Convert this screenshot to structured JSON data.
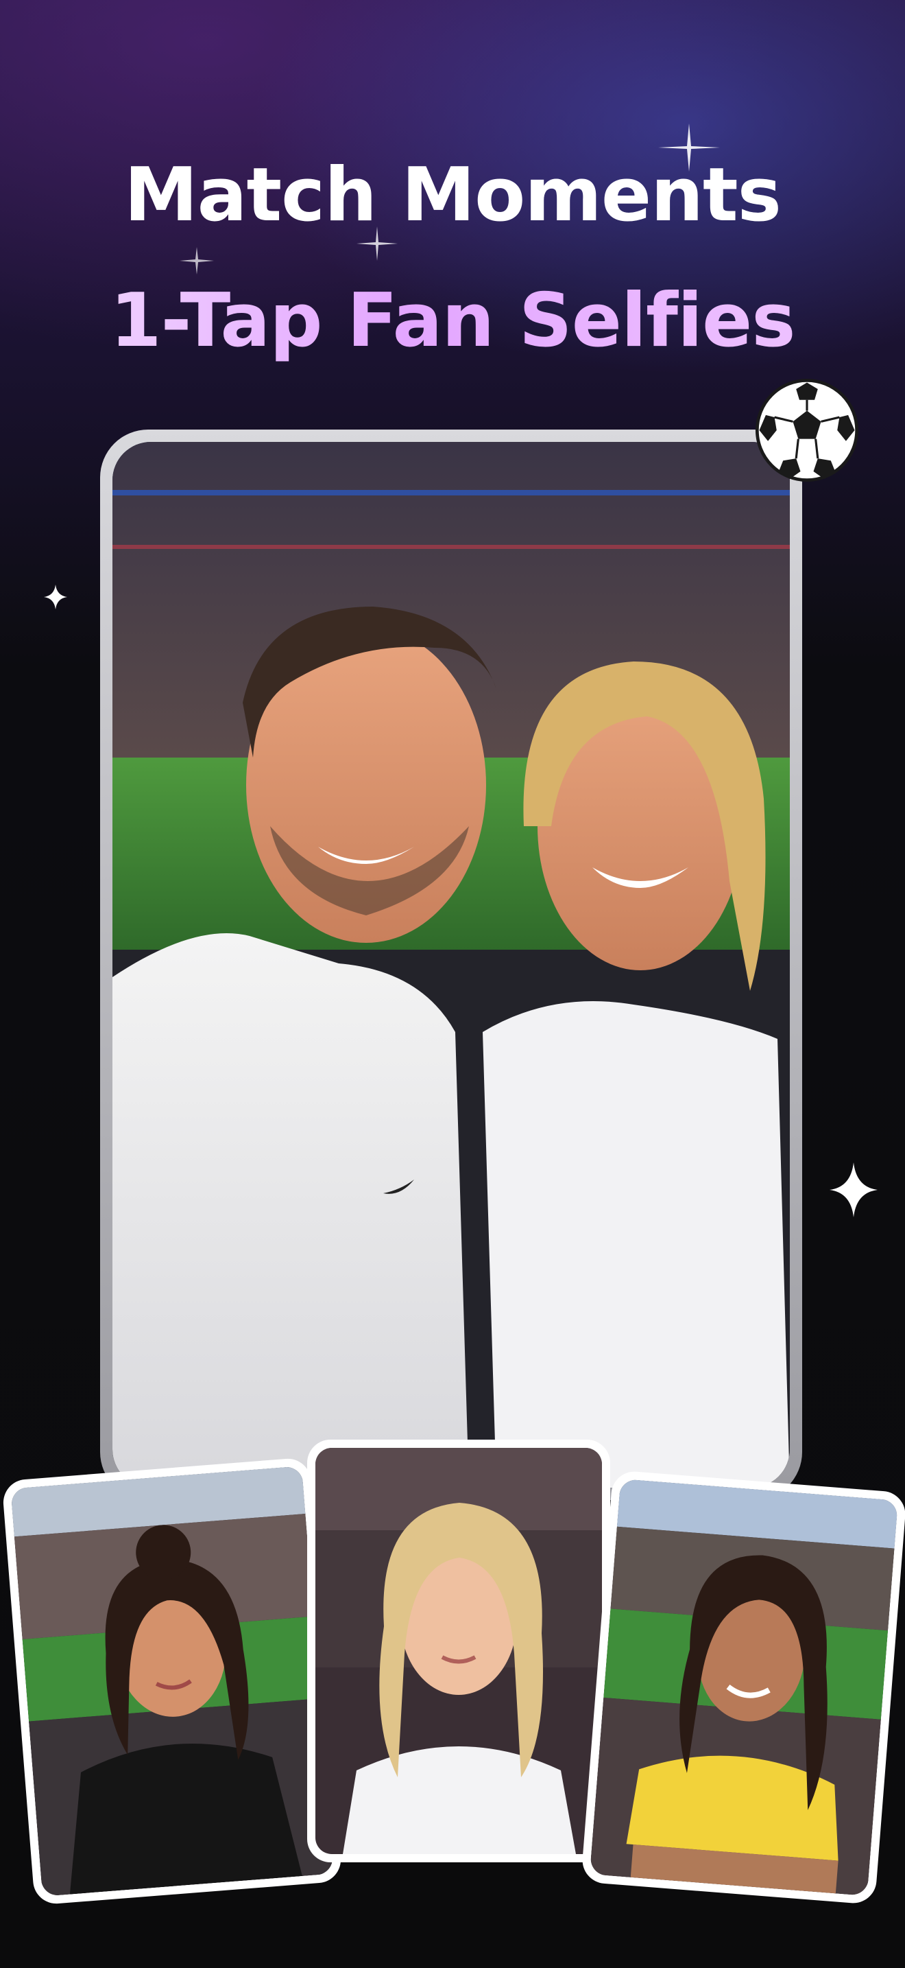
{
  "headline": {
    "line1": "Match Moments",
    "line2": "1-Tap Fan Selfies"
  },
  "icons": {
    "ball": "soccer-ball-icon",
    "sparkle": "sparkle-icon"
  },
  "colors": {
    "background": "#0b0b0c",
    "headline_primary": "#ffffff",
    "headline_accent": "#e3a6ff",
    "frame_border": "#d0d0d5"
  }
}
